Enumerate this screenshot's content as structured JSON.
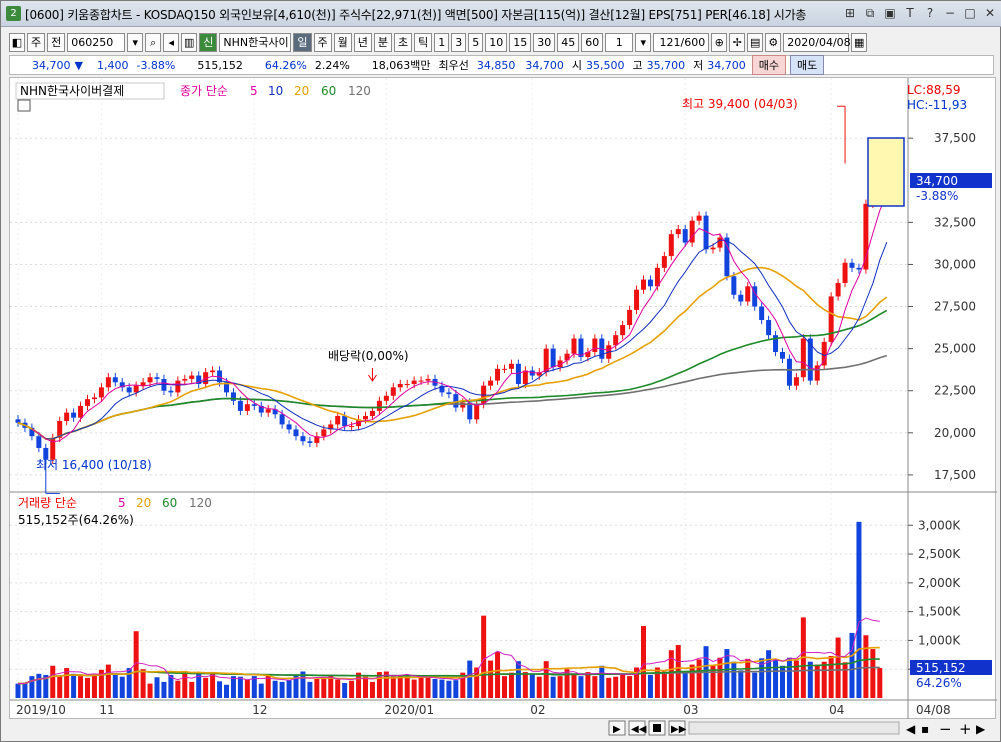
{
  "window": {
    "title": "[0600] 키움종합차트 - KOSDAQ150 외국인보유[4,610(천)] 주식수[22,971(천)] 액면[500] 자본금[115(억)] 결산[12월] EPS[751] PER[46.18] 시가총",
    "icon": "2"
  },
  "toolbar": {
    "market": "주",
    "prev": "전",
    "code": "060250",
    "badge": "신",
    "stock_name": "NHN한국사이",
    "periods": [
      "일",
      "주",
      "월",
      "년",
      "분",
      "초",
      "틱"
    ],
    "nums": [
      "1",
      "3",
      "5",
      "10",
      "15",
      "30",
      "45",
      "60"
    ],
    "interval": "1",
    "count": "121/600",
    "date": "2020/04/08"
  },
  "quote": {
    "price": "34,700",
    "arrow": "▼",
    "change": "1,400",
    "pct": "-3.88%",
    "volume": "515,152",
    "vol_ratio": "64.26%",
    "turnover_rate": "2.24%",
    "amount": "18,063백만",
    "bid_label": "최우선",
    "bid1": "34,850",
    "bid2": "34,700",
    "open_label": "시",
    "open": "35,500",
    "high_label": "고",
    "high": "35,700",
    "low_label": "저",
    "low": "34,700",
    "buy": "매수",
    "sell": "매도"
  },
  "price_panel": {
    "legend_name": "NHN한국사이버결제",
    "ma_label": "종가 단순",
    "ma_periods": [
      "5",
      "10",
      "20",
      "60",
      "120"
    ],
    "lc": "LC:88,59",
    "hc": "HC:-11,93",
    "high_note": "최고 39,400 (04/03)",
    "low_note": "최저 16,400 (10/18)",
    "dividend_note": "배당락(0,00%)",
    "current_price": "34,700",
    "current_pct": "-3.88%"
  },
  "volume_panel": {
    "legend": "거래량 단순",
    "ma_periods": [
      "5",
      "20",
      "60",
      "120"
    ],
    "current_text": "515,152주(64.26%)",
    "current_volume": "515,152",
    "current_pct": "64.26%"
  },
  "x_axis": {
    "labels": [
      "2019/10",
      "11",
      "12",
      "2020/01",
      "02",
      "03",
      "04",
      "04/08"
    ]
  },
  "colors": {
    "up": "#ee1111",
    "down": "#1144dd",
    "ma5": "#e000a0",
    "ma10": "#1030c0",
    "ma20": "#e6a000",
    "ma60": "#1f8a2a",
    "ma120": "#707070",
    "vol_ma": "#d020c0"
  },
  "chart_data": {
    "type": "candlestick",
    "price_axis": {
      "ticks": [
        17500,
        20000,
        22500,
        25000,
        27500,
        30000,
        32500,
        37500
      ],
      "range": [
        16900,
        40600
      ]
    },
    "volume_axis": {
      "ticks": [
        500000,
        1000000,
        1500000,
        2000000,
        2500000,
        3000000
      ],
      "unit_label": "K",
      "range": [
        0,
        3300000
      ]
    },
    "closes": [
      20600,
      20300,
      19800,
      19100,
      18400,
      19700,
      20700,
      21200,
      20900,
      21600,
      22000,
      22100,
      22700,
      23300,
      23000,
      22700,
      22400,
      22800,
      23000,
      23300,
      23200,
      22500,
      22400,
      23100,
      23200,
      23400,
      22900,
      23600,
      23700,
      23000,
      22400,
      21900,
      21300,
      21700,
      21600,
      21200,
      21400,
      21100,
      20500,
      20200,
      19800,
      19500,
      19400,
      19800,
      20200,
      20500,
      21000,
      20400,
      20400,
      20800,
      21000,
      21300,
      21900,
      22200,
      22700,
      22900,
      22900,
      23100,
      23100,
      23200,
      22800,
      22400,
      22300,
      21500,
      21800,
      20800,
      21700,
      22800,
      23100,
      23800,
      23800,
      24100,
      22900,
      23700,
      23400,
      23600,
      25000,
      23900,
      24300,
      24700,
      25600,
      24500,
      24800,
      25600,
      24400,
      25200,
      25800,
      26400,
      27300,
      28500,
      29100,
      28700,
      29800,
      30500,
      31800,
      32100,
      31300,
      32600,
      32900,
      30900,
      31000,
      31600,
      29300,
      28200,
      27800,
      28700,
      27500,
      26700,
      25800,
      24800,
      24400,
      22800,
      23300,
      25600,
      23100,
      24000,
      25400,
      28100,
      28900,
      30100,
      29800,
      29700,
      33600,
      36100,
      36800,
      34700
    ],
    "volumes": [
      250000,
      260000,
      380000,
      420000,
      400000,
      560000,
      380000,
      520000,
      420000,
      380000,
      350000,
      420000,
      490000,
      580000,
      430000,
      370000,
      520000,
      1160000,
      500000,
      250000,
      360000,
      280000,
      400000,
      300000,
      470000,
      280000,
      450000,
      350000,
      440000,
      290000,
      230000,
      380000,
      370000,
      320000,
      380000,
      250000,
      400000,
      300000,
      280000,
      310000,
      400000,
      460000,
      280000,
      330000,
      330000,
      400000,
      320000,
      260000,
      300000,
      440000,
      370000,
      280000,
      450000,
      460000,
      370000,
      400000,
      370000,
      320000,
      380000,
      350000,
      330000,
      320000,
      300000,
      310000,
      440000,
      650000,
      530000,
      1430000,
      650000,
      800000,
      380000,
      440000,
      640000,
      450000,
      410000,
      370000,
      640000,
      370000,
      380000,
      500000,
      400000,
      380000,
      450000,
      380000,
      560000,
      350000,
      370000,
      410000,
      380000,
      530000,
      1250000,
      400000,
      530000,
      460000,
      830000,
      920000,
      450000,
      580000,
      670000,
      900000,
      560000,
      700000,
      850000,
      630000,
      480000,
      680000,
      440000,
      690000,
      830000,
      680000,
      560000,
      700000,
      650000,
      1400000,
      630000,
      580000,
      630000,
      730000,
      1050000,
      620000,
      1130000,
      3060000,
      1090000,
      850000,
      520000
    ],
    "high": {
      "value": 39400,
      "date": "04/03"
    },
    "low": {
      "value": 16400,
      "date": "10/18"
    }
  }
}
